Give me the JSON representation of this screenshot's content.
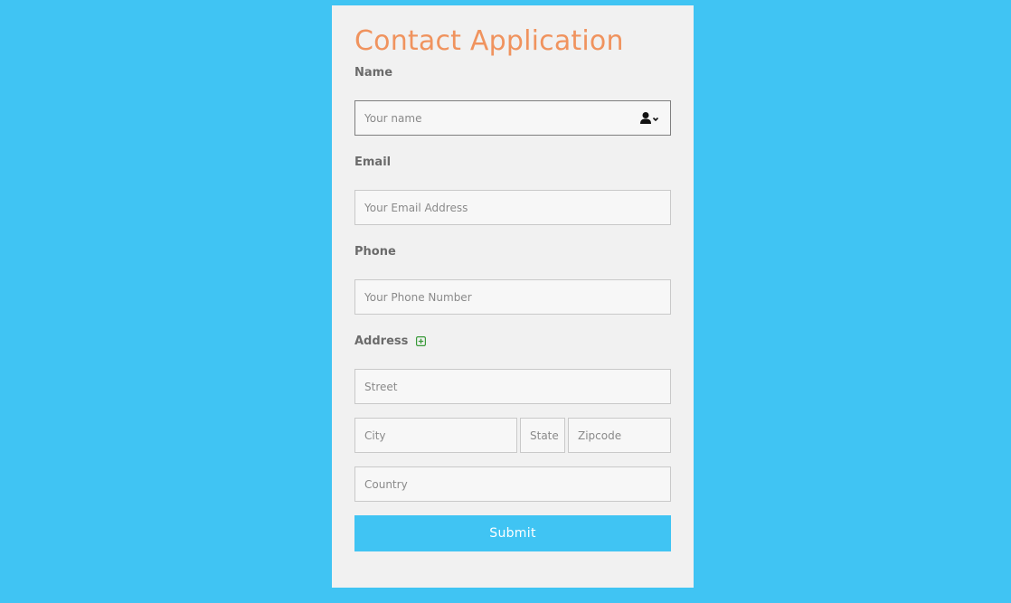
{
  "form": {
    "title": "Contact Application",
    "name": {
      "label": "Name",
      "placeholder": "Your name",
      "addon_icon": "user-dropdown-icon"
    },
    "email": {
      "label": "Email",
      "placeholder": "Your Email Address"
    },
    "phone": {
      "label": "Phone",
      "placeholder": "Your Phone Number"
    },
    "address": {
      "label": "Address",
      "add_icon": "plus-square-icon",
      "street_placeholder": "Street",
      "city_placeholder": "City",
      "state_placeholder": "State",
      "zipcode_placeholder": "Zipcode",
      "country_placeholder": "Country"
    },
    "submit_label": "Submit"
  },
  "colors": {
    "background": "#40c4f3",
    "card": "#f1f1f1",
    "title": "#f0935e",
    "add_icon": "#3a9a3a",
    "submit_bg": "#40c4f3"
  }
}
